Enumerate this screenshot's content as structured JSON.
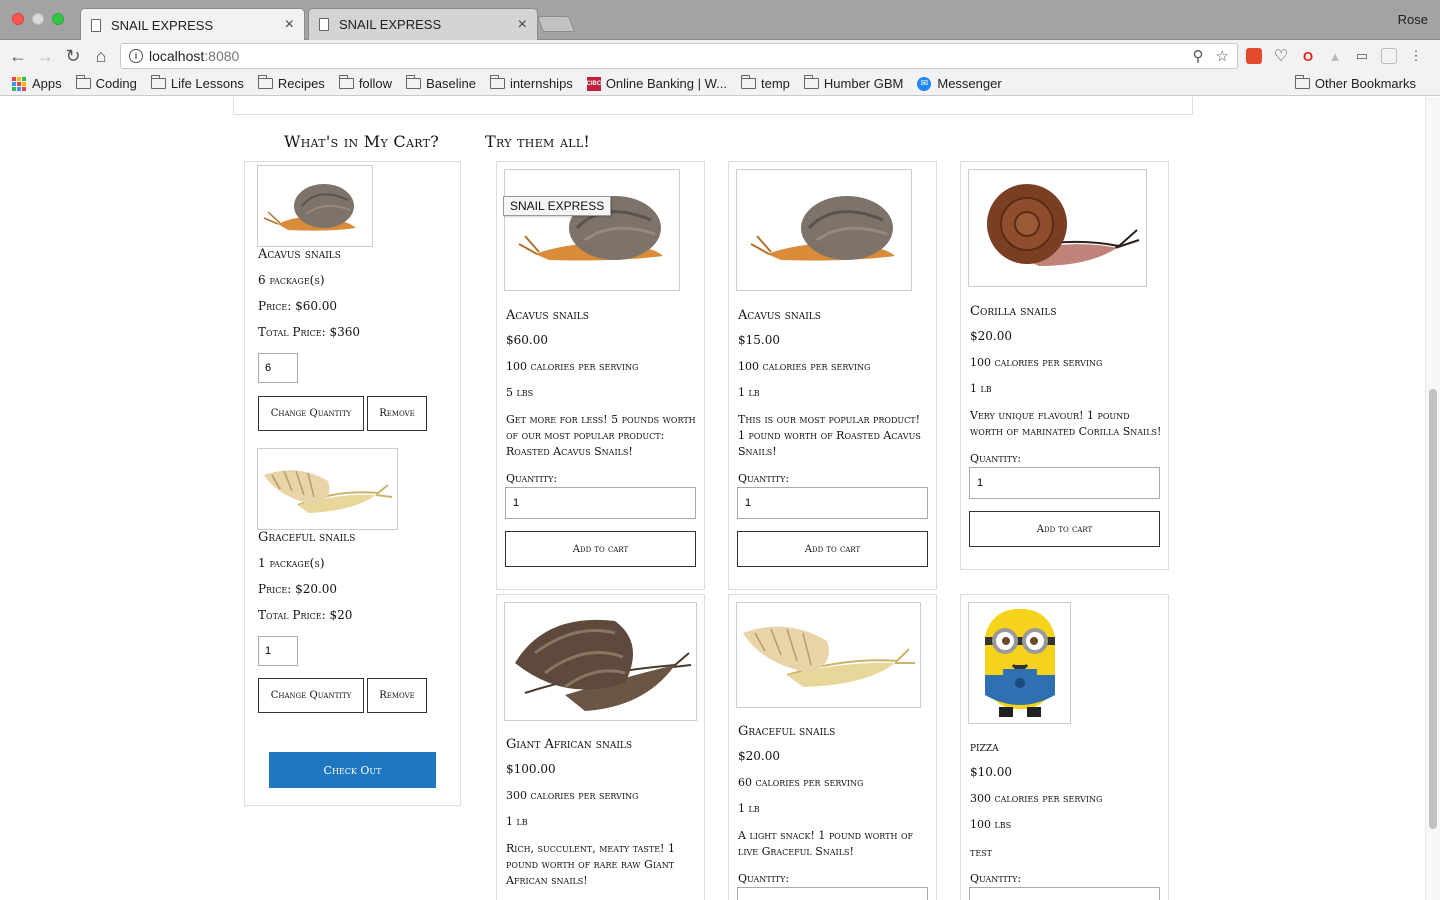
{
  "browser": {
    "tabs": [
      {
        "title": "SNAIL EXPRESS",
        "active": true
      },
      {
        "title": "SNAIL EXPRESS",
        "active": false
      }
    ],
    "profile": "Rose",
    "url": {
      "host": "localhost",
      "port": ":8080"
    },
    "bookmarks": [
      "Apps",
      "Coding",
      "Life Lessons",
      "Recipes",
      "follow",
      "Baseline",
      "internships",
      "Online Banking | W...",
      "temp",
      "Humber GBM",
      "Messenger"
    ],
    "other_bookmarks": "Other Bookmarks",
    "colors": {
      "tabbar": "#a3a3a3",
      "toolbar": "#f2f2f2"
    }
  },
  "cart": {
    "title": "What's in My Cart?",
    "items": [
      {
        "name": "Acavus snails",
        "packages": "6 package(s)",
        "price": "Price: $60.00",
        "total": "Total Price: $360",
        "qty": "6",
        "change_label": "Change Quantity",
        "remove_label": "Remove"
      },
      {
        "name": "Graceful snails",
        "packages": "1 package(s)",
        "price": "Price: $20.00",
        "total": "Total Price: $20",
        "qty": "1",
        "change_label": "Change Quantity",
        "remove_label": "Remove"
      }
    ],
    "checkout_label": "Check Out",
    "checkout_color": "#1f77c0"
  },
  "shop": {
    "title": "Try them all!",
    "tooltip": "SNAIL EXPRESS",
    "quantity_label": "Quantity:",
    "add_label": "Add to cart",
    "products": [
      {
        "name": "Acavus snails",
        "price": "$60.00",
        "calories": "100 calories per serving",
        "weight": "5 lbs",
        "desc": "Get more for less! 5 pounds worth of our most popular product: Roasted Acavus Snails!",
        "qty": "1",
        "image": "acavus-snail"
      },
      {
        "name": "Acavus snails",
        "price": "$15.00",
        "calories": "100 calories per serving",
        "weight": "1 lb",
        "desc": "This is our most popular product! 1 pound worth of Roasted Acavus Snails!",
        "qty": "1",
        "image": "acavus-snail"
      },
      {
        "name": "Corilla snails",
        "price": "$20.00",
        "calories": "100 calories per serving",
        "weight": "1 lb",
        "desc": "Very unique flavour! 1 pound worth of marinated Corilla Snails!",
        "qty": "1",
        "image": "corilla-snail"
      },
      {
        "name": "Giant African snails",
        "price": "$100.00",
        "calories": "300 calories per serving",
        "weight": "1 lb",
        "desc": "Rich, succulent, meaty taste! 1 pound worth of rare raw Giant African snails!",
        "image": "giant-african-snail"
      },
      {
        "name": "Graceful snails",
        "price": "$20.00",
        "calories": "60 calories per serving",
        "weight": "1 lb",
        "desc": "A light snack! 1 pound worth of live Graceful Snails!",
        "image": "graceful-snail"
      },
      {
        "name": "pizza",
        "price": "$10.00",
        "calories": "300 calories per serving",
        "weight": "100 lbs",
        "desc": "test",
        "image": "minion"
      }
    ]
  }
}
